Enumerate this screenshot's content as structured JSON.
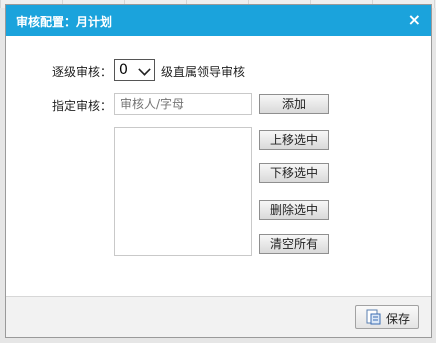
{
  "dialog": {
    "title": "审核配置：月计划",
    "close_symbol": "×"
  },
  "level_review": {
    "label": "逐级审核：",
    "selected": "0",
    "suffix": "级直属领导审核"
  },
  "assign_review": {
    "label": "指定审核：",
    "placeholder": "审核人/字母"
  },
  "buttons": {
    "add": "添加",
    "move_up": "上移选中",
    "move_down": "下移选中",
    "delete": "删除选中",
    "clear": "清空所有"
  },
  "footer": {
    "save": "保存",
    "save_icon": "save-icon"
  },
  "colors": {
    "titlebar": "#1ba3dc"
  }
}
